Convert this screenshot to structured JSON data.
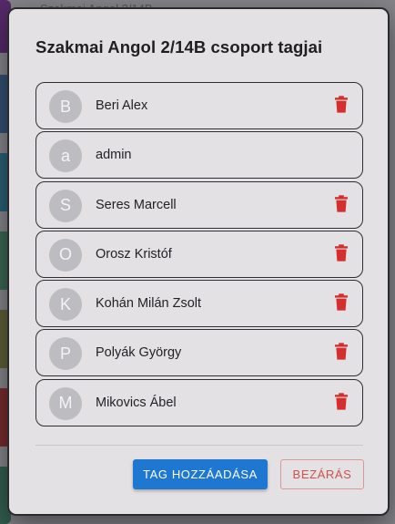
{
  "background": {
    "top_text": "Szakmai Angol 2/14B",
    "strip_colors": [
      "#7a2a9a",
      "#3b6fa8",
      "#2a8fae",
      "#4a9a70",
      "#8a8a40",
      "#b8302c",
      "#3a8a68"
    ]
  },
  "dialog": {
    "title": "Szakmai Angol 2/14B csoport tagjai",
    "members": [
      {
        "initial": "B",
        "name": "Beri Alex",
        "deletable": true
      },
      {
        "initial": "a",
        "name": "admin",
        "deletable": false
      },
      {
        "initial": "S",
        "name": "Seres Marcell",
        "deletable": true
      },
      {
        "initial": "O",
        "name": "Orosz Kristóf",
        "deletable": true
      },
      {
        "initial": "K",
        "name": "Kohán Milán Zsolt",
        "deletable": true
      },
      {
        "initial": "P",
        "name": "Polyák György",
        "deletable": true
      },
      {
        "initial": "M",
        "name": "Mikovics Ábel",
        "deletable": true
      }
    ],
    "delete_icon": "trash-icon",
    "add_button_label": "TAG HOZZÁADÁSA",
    "close_button_label": "BEZÁRÁS"
  },
  "colors": {
    "primary": "#1e78d2",
    "danger": "#d32f2f",
    "avatar_bg": "#bdbcc0",
    "dialog_bg": "#e3e1e3"
  }
}
